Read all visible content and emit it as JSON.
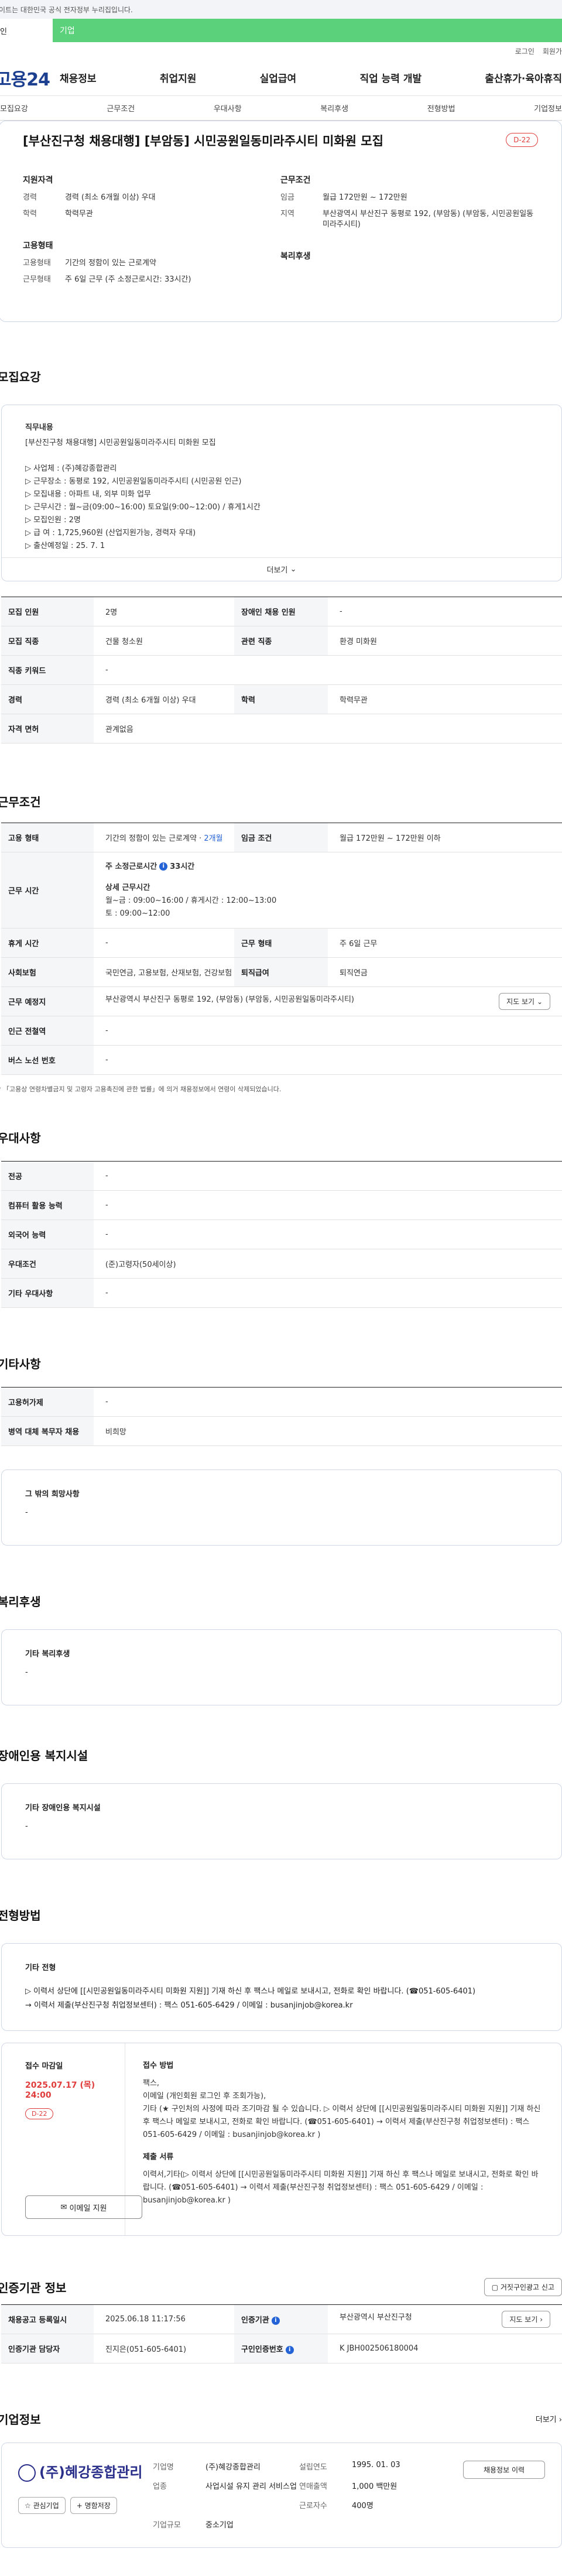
{
  "gov_banner": "이트는 대한민국 공식 전자정부 누리집입니다.",
  "member_tabs": {
    "person": "인",
    "corp": "기업"
  },
  "util": {
    "login": "로그인",
    "join": "회원가"
  },
  "gnb": {
    "logo": "고용24",
    "menu": [
      "채용정보",
      "취업지원",
      "실업급여",
      "직업 능력 개발",
      "출산휴가·육아휴직"
    ]
  },
  "tabs": [
    "모집요강",
    "근무조건",
    "우대사항",
    "복리후생",
    "전형방법",
    "기업정보"
  ],
  "summary": {
    "title": "[부산진구청 채용대행] [부암동] 시민공원일동미라주시티 미화원 모집",
    "dday": "D-22",
    "qual_title": "지원자격",
    "qual": [
      {
        "k": "경력",
        "v": "경력 (최소 6개월 이상) 우대"
      },
      {
        "k": "학력",
        "v": "학력무관"
      }
    ],
    "work_title": "근무조건",
    "work": [
      {
        "k": "임금",
        "v": "월급 172만원 ~ 172만원"
      },
      {
        "k": "지역",
        "v": "부산광역시 부산진구 동평로 192, (부암동) (부암동, 시민공원일동미라주시티)"
      }
    ],
    "emp_title": "고용형태",
    "emp": [
      {
        "k": "고용형태",
        "v": "기간의 정함이 있는 근로계약"
      },
      {
        "k": "근무형태",
        "v": "주 6일 근무 (주 소정근로시간: 33시간)"
      }
    ],
    "welfare_title": "복리후생"
  },
  "recruit": {
    "section": "모집요강",
    "detail_title": "직무내용",
    "detail_lines": [
      "[부산진구청 채용대행] 시민공원일동미라주시티 미화원 모집",
      "",
      "▷ 사업체 : (주)혜강종합관리",
      "▷ 근무장소 : 동평로 192, 시민공원일동미라주시티 (시민공원 인근)",
      "▷ 모집내용 : 아파트 내, 외부 미화 업무",
      "▷ 근무시간 : 월~금(09:00~16:00) 토요일(9:00~12:00) / 휴게1시간",
      "▷ 모집인원 : 2명",
      "▷ 급 여 : 1,725,960원 (산업지원가능, 경력자 우대)",
      "▷ 출산예정일 : 25. 7. 1"
    ],
    "more": "더보기",
    "rows": [
      [
        {
          "k": "모집 인원",
          "v": "2명"
        },
        {
          "k": "장애인 채용 인원",
          "v": "-"
        }
      ],
      [
        {
          "k": "모집 직종",
          "v": "건물 청소원"
        },
        {
          "k": "관련 직종",
          "v": "환경 미화원"
        }
      ],
      [
        {
          "k": "직종 키워드",
          "v": "-"
        }
      ],
      [
        {
          "k": "경력",
          "v": "경력 (최소 6개월 이상) 우대"
        },
        {
          "k": "학력",
          "v": "학력무관"
        }
      ],
      [
        {
          "k": "자격 면허",
          "v": "관계없음"
        }
      ]
    ]
  },
  "conditions": {
    "section": "근무조건",
    "emp_k": "고용 형태",
    "emp_v": "기간의 정함이 있는 근로계약 · ",
    "emp_v_blue": "2개월",
    "wage_k": "임금 조건",
    "wage_v": "월급 172만원 ~ 172만원 이하",
    "hours_k": "근무 시간",
    "hours_title": "주 소정근로시간",
    "hours_val": "33시간",
    "hours_detail_title": "상세 근무시간",
    "hours_detail": [
      "월~금 : 09:00~16:00 / 휴게시간 : 12:00~13:00",
      "토 : 09:00~12:00"
    ],
    "break_k": "휴게 시간",
    "break_v": "-",
    "form_k": "근무 형태",
    "form_v": "주 6일 근무",
    "ins_k": "사회보험",
    "ins_v": "국민연금, 고용보험, 산재보험, 건강보험",
    "ret_k": "퇴직급여",
    "ret_v": "퇴직연금",
    "place_k": "근무 예정지",
    "place_v": "부산광역시 부산진구 동평로 192, (부암동) (부암동, 시민공원일동미라주시티)",
    "map": "지도 보기",
    "subway_k": "인근 전철역",
    "subway_v": "-",
    "bus_k": "버스 노선 번호",
    "bus_v": "-",
    "footnote": "「고용상 연령차별금지 및 고령자 고용촉진에 관한 법률」에 의거 채용정보에서 연령이 삭제되었습니다."
  },
  "preference": {
    "section": "우대사항",
    "rows": [
      {
        "k": "전공",
        "v": "-"
      },
      {
        "k": "컴퓨터 활용 능력",
        "v": "-"
      },
      {
        "k": "외국어 능력",
        "v": "-"
      },
      {
        "k": "우대조건",
        "v": "(준)고령자(50세이상)"
      },
      {
        "k": "기타 우대사항",
        "v": "-"
      }
    ]
  },
  "etc": {
    "section": "기타사항",
    "rows": [
      {
        "k": "고용허가제",
        "v": "-"
      },
      {
        "k": "병역 대체 복무자 채용",
        "v": "비희망"
      }
    ],
    "wish_title": "그 밖의 희망사항",
    "wish_v": "-"
  },
  "welfare": {
    "section": "복리후생",
    "title": "기타 복리후생",
    "v": "-"
  },
  "disabled": {
    "section": "장애인용 복지시설",
    "title": "기타 장애인용 복지시설",
    "v": "-"
  },
  "selection": {
    "section": "전형방법",
    "title": "기타 전형",
    "lines": [
      "▷ 이력서 상단에 [[시민공원일동미라주시티 미화원 지원]] 기재 하신 후 팩스나 메일로 보내시고, 전화로 확인 바랍니다. (☎051-605-6401)",
      "→ 이력서 제출(부산진구청 취업정보센터) : 팩스 051-605-6429 / 이메일 : busanjinjob@korea.kr"
    ]
  },
  "apply": {
    "deadline_title": "접수 마감일",
    "deadline": "2025.07.17 (목) 24:00",
    "dday": "D-22",
    "email_btn": "이메일 지원",
    "method_title": "접수 방법",
    "method_lines": [
      "팩스,",
      "이메일 (개인회원 로그인 후 조회가능),",
      "기타 (★ 구인처의 사정에 따라 조기마감 될 수 있습니다. ▷ 이력서 상단에 [[시민공원일동미라주시티 미화원 지원]] 기재 하신 후 팩스나 메일로 보내시고, 전화로 확인 바랍니다. (☎051-605-6401) → 이력서 제출(부산진구청 취업정보센터) : 팩스 051-605-6429 / 이메일 : busanjinjob@korea.kr )"
    ],
    "docs_title": "제출 서류",
    "docs_lines": [
      "이력서,기타(▷ 이력서 상단에 [[시민공원일동미라주시티 미화원 지원]] 기재 하신 후 팩스나 메일로 보내시고, 전화로 확인 바랍니다. (☎051-605-6401) → 이력서 제출(부산진구청 취업정보센터) : 팩스 051-605-6429 / 이메일 : busanjinjob@korea.kr )"
    ]
  },
  "institution": {
    "section": "인증기관 정보",
    "report_btn": "거짓구인광고 신고",
    "rows": [
      [
        {
          "k": "채용공고 등록일시",
          "v": "2025.06.18 11:17:56"
        },
        {
          "k": "인증기관",
          "v": "부산광역시 부산진구청",
          "btn": "지도 보기"
        }
      ],
      [
        {
          "k": "인증기관 담당자",
          "v": "진지은(051-605-6401)"
        },
        {
          "k": "구인인증번호",
          "v": "K JBH002506180004"
        }
      ]
    ]
  },
  "company": {
    "section": "기업정보",
    "more": "더보기",
    "logo_text": "(주)혜강종합관리",
    "btn_fav": "관심기업",
    "btn_share": "명함저장",
    "fields": [
      {
        "k": "기업명",
        "v": "(주)혜강종합관리"
      },
      {
        "k": "설립연도",
        "v": "1995. 01. 03"
      },
      {
        "k": "업종",
        "v": "사업시설 유지 관리 서비스업"
      },
      {
        "k": "연매출액",
        "v": "1,000 백만원"
      },
      {
        "k": "",
        "v": ""
      },
      {
        "k": "근로자수",
        "v": "400명"
      },
      {
        "k": "기업규모",
        "v": "중소기업"
      }
    ],
    "jobs_btn": "채용정보 이력"
  }
}
